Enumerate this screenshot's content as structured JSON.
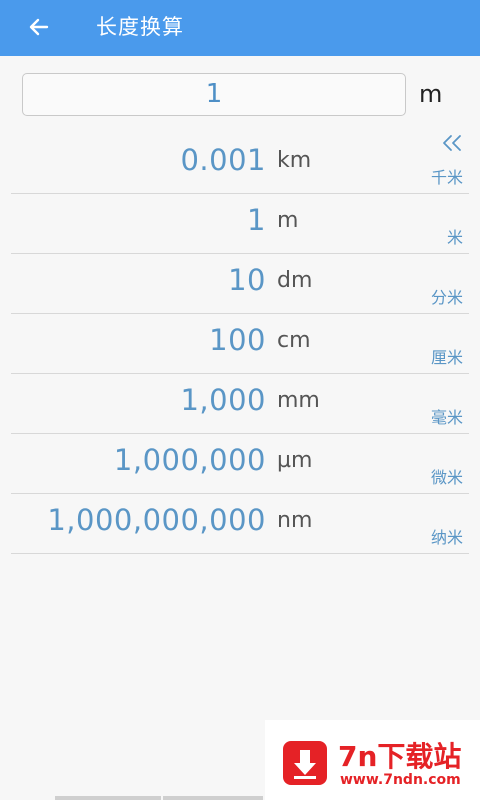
{
  "header": {
    "title": "长度换算"
  },
  "input": {
    "value": "1",
    "unit": "m"
  },
  "rows": [
    {
      "value": "0.001",
      "symbol": "km",
      "name": "千米"
    },
    {
      "value": "1",
      "symbol": "m",
      "name": "米"
    },
    {
      "value": "10",
      "symbol": "dm",
      "name": "分米"
    },
    {
      "value": "100",
      "symbol": "cm",
      "name": "厘米"
    },
    {
      "value": "1,000",
      "symbol": "mm",
      "name": "毫米"
    },
    {
      "value": "1,000,000",
      "symbol": "µm",
      "name": "微米"
    },
    {
      "value": "1,000,000,000",
      "symbol": "nm",
      "name": "纳米"
    }
  ],
  "watermark": {
    "title": "7n下载站",
    "url": "www.7ndn.com"
  },
  "colors": {
    "appbar": "#4a9aec",
    "value_text": "#5a96c6",
    "watermark": "#e52226"
  },
  "icons": {
    "back": "arrow-left-icon",
    "collapse": "double-chevron-left-icon",
    "watermark": "download-arrow-icon"
  }
}
